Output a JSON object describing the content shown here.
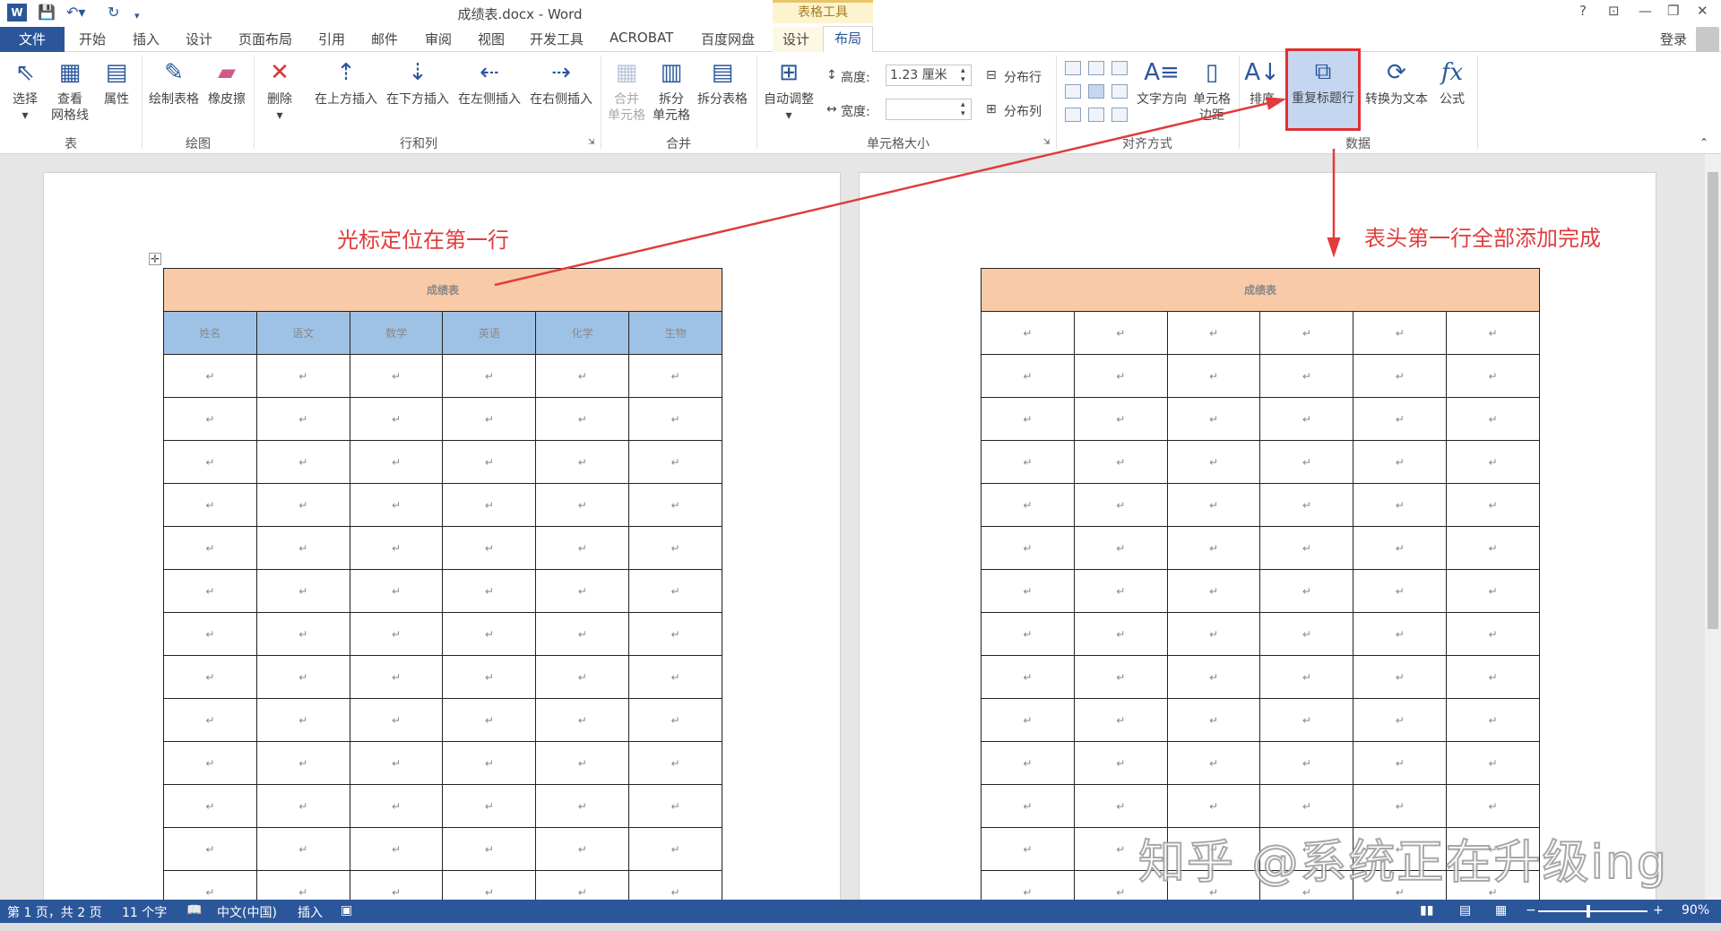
{
  "titlebar": {
    "doc_title": "成绩表.docx - Word",
    "context_group": "表格工具",
    "help": "?",
    "min": "—",
    "restore": "❐",
    "close": "✕",
    "opts": "⊡"
  },
  "tabs": {
    "file": "文件",
    "home": "开始",
    "insert": "插入",
    "design": "设计",
    "page_layout": "页面布局",
    "references": "引用",
    "mailings": "邮件",
    "review": "审阅",
    "view": "视图",
    "developer": "开发工具",
    "acrobat": "ACROBAT",
    "baidu": "百度网盘",
    "table_design": "设计",
    "table_layout": "布局",
    "login": "登录"
  },
  "ribbon": {
    "select": "选择",
    "view_gridlines": "查看\n网格线",
    "properties": "属性",
    "group_table": "表",
    "draw_table": "绘制表格",
    "eraser": "橡皮擦",
    "group_draw": "绘图",
    "delete": "删除",
    "insert_above": "在上方插入",
    "insert_below": "在下方插入",
    "insert_left": "在左侧插入",
    "insert_right": "在右侧插入",
    "group_rows_cols": "行和列",
    "merge_cells": "合并\n单元格",
    "split_cells": "拆分\n单元格",
    "split_table": "拆分表格",
    "group_merge": "合并",
    "autofit": "自动调整",
    "height_label": "高度:",
    "height_value": "1.23 厘米",
    "width_label": "宽度:",
    "width_value": "",
    "dist_rows": "分布行",
    "dist_cols": "分布列",
    "group_cell_size": "单元格大小",
    "text_direction": "文字方向",
    "cell_margins": "单元格\n边距",
    "group_alignment": "对齐方式",
    "sort": "排序",
    "repeat_header": "重复标题行",
    "convert_text": "转换为文本",
    "formula": "公式",
    "group_data": "数据"
  },
  "annotations": {
    "left": "光标定位在第一行",
    "right": "表头第一行全部添加完成"
  },
  "table": {
    "title": "成绩表",
    "headers": [
      "姓名",
      "语文",
      "数学",
      "英语",
      "化学",
      "生物"
    ],
    "cell_mark": "↵"
  },
  "watermark": "知乎 @系统正在升级ing",
  "status": {
    "page": "第 1 页，共 2 页",
    "words": "11 个字",
    "lang": "中文(中国)",
    "mode": "插入",
    "zoom": "90%"
  },
  "colors": {
    "brand": "#2b579a",
    "annotation": "#e03c3c",
    "title_fill": "#f8caa8",
    "header_fill": "#9ec2e5"
  }
}
